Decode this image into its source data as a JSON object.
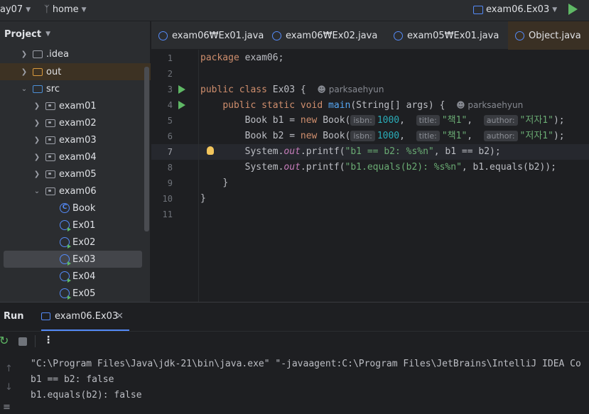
{
  "topbar": {
    "project_fragment": "ay07",
    "branch": "home",
    "run_config": "exam06.Ex03"
  },
  "sidebar": {
    "title": "Project",
    "items": [
      {
        "label": ".idea"
      },
      {
        "label": "out"
      },
      {
        "label": "src"
      },
      {
        "label": "exam01"
      },
      {
        "label": "exam02"
      },
      {
        "label": "exam03"
      },
      {
        "label": "exam04"
      },
      {
        "label": "exam05"
      },
      {
        "label": "exam06"
      },
      {
        "label": "Book"
      },
      {
        "label": "Ex01"
      },
      {
        "label": "Ex02"
      },
      {
        "label": "Ex03"
      },
      {
        "label": "Ex04"
      },
      {
        "label": "Ex05"
      }
    ]
  },
  "tabs": [
    {
      "label": "exam06₩Ex01.java"
    },
    {
      "label": "exam06₩Ex02.java"
    },
    {
      "label": "exam05₩Ex01.java"
    },
    {
      "label": "Object.java"
    }
  ],
  "editor": {
    "line_numbers": [
      "1",
      "2",
      "3",
      "4",
      "5",
      "6",
      "7",
      "8",
      "9",
      "10",
      "11"
    ],
    "author": "parksaehyun",
    "code": {
      "l1_kw": "package",
      "l1_rest": " exam06;",
      "l3_kw1": "public",
      "l3_kw2": "class",
      "l3_rest": " Ex03 {",
      "l4_kw1": "public",
      "l4_kw2": "static",
      "l4_kw3": "void",
      "l4_fn": "main",
      "l4_rest": "(String[] args) {",
      "l5_a": "Book b1 = ",
      "l6_a": "Book b2 = ",
      "kw_new": "new",
      "book_open": " Book(",
      "hint_isbn": "isbn:",
      "isbn_val": "1000",
      "hint_title": "title:",
      "title_val": "\"책1\"",
      "hint_author": "author:",
      "author_val": "\"저자1\"",
      "close": ");",
      "comma": ",",
      "system": "System.",
      "out": "out",
      "printf": ".printf(",
      "l7_str": "\"b1 == b2: %s%n\"",
      "l7_rest": ", b1 == b2);",
      "l8_str": "\"b1.equals(b2): %s%n\"",
      "l8_rest": ", b1.equals(b2));",
      "l9": "}",
      "l10": "}"
    }
  },
  "run": {
    "title": "Run",
    "tab_label": "exam06.Ex03",
    "console": [
      "\"C:\\Program Files\\Java\\jdk-21\\bin\\java.exe\" \"-javaagent:C:\\Program Files\\JetBrains\\IntelliJ IDEA Co",
      "b1 == b2: false",
      "b1.equals(b2): false"
    ]
  },
  "colors": {
    "background": "#1e1f22",
    "panel": "#2b2d30",
    "keyword": "#cf8e6d",
    "string": "#6aab73",
    "number": "#2aacb8",
    "function": "#56a8f5",
    "static_field": "#c77dbb",
    "run_green": "#5fb865",
    "accent_blue": "#548af7"
  }
}
